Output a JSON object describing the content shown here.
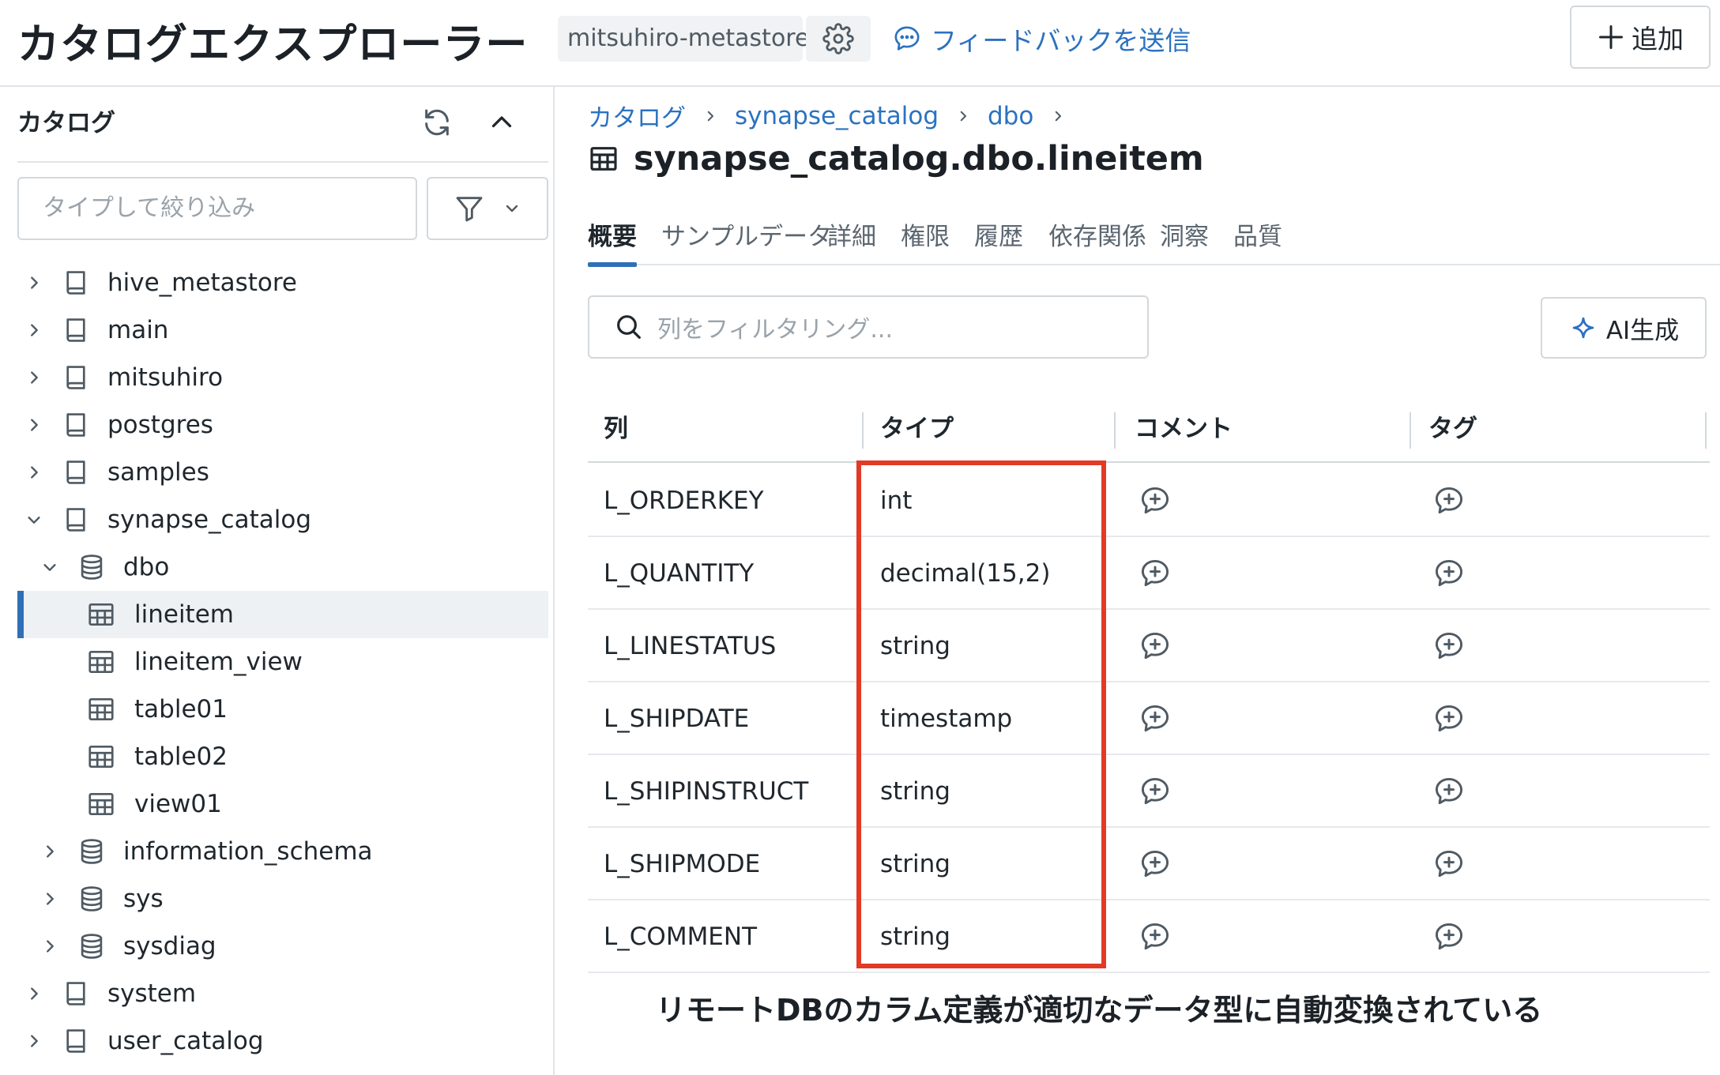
{
  "header": {
    "title": "カタログエクスプローラー",
    "metastore": "mitsuhiro-metastore",
    "feedback_label": "フィードバックを送信",
    "add_label": "追加"
  },
  "sidebar": {
    "title": "カタログ",
    "filter_placeholder": "タイプして絞り込み",
    "items": [
      {
        "label": "hive_metastore",
        "icon": "catalog-book-icon",
        "level": 0,
        "expanded": false
      },
      {
        "label": "main",
        "icon": "catalog-book-icon",
        "level": 0,
        "expanded": false
      },
      {
        "label": "mitsuhiro",
        "icon": "catalog-book-icon",
        "level": 0,
        "expanded": false
      },
      {
        "label": "postgres",
        "icon": "catalog-book-icon",
        "level": 0,
        "expanded": false
      },
      {
        "label": "samples",
        "icon": "catalog-book-icon",
        "level": 0,
        "expanded": false
      },
      {
        "label": "synapse_catalog",
        "icon": "catalog-book-icon",
        "level": 0,
        "expanded": true
      },
      {
        "label": "dbo",
        "icon": "database-icon",
        "level": 1,
        "expanded": true
      },
      {
        "label": "lineitem",
        "icon": "table-icon",
        "level": 2,
        "selected": true
      },
      {
        "label": "lineitem_view",
        "icon": "table-icon",
        "level": 2
      },
      {
        "label": "table01",
        "icon": "table-icon",
        "level": 2
      },
      {
        "label": "table02",
        "icon": "table-icon",
        "level": 2
      },
      {
        "label": "view01",
        "icon": "table-icon",
        "level": 2
      },
      {
        "label": "information_schema",
        "icon": "database-icon",
        "level": 1,
        "expanded": false
      },
      {
        "label": "sys",
        "icon": "database-icon",
        "level": 1,
        "expanded": false
      },
      {
        "label": "sysdiag",
        "icon": "database-icon",
        "level": 1,
        "expanded": false
      },
      {
        "label": "system",
        "icon": "catalog-book-icon",
        "level": 0,
        "expanded": false
      },
      {
        "label": "user_catalog",
        "icon": "catalog-book-icon",
        "level": 0,
        "expanded": false
      }
    ]
  },
  "main": {
    "breadcrumb": [
      "カタログ",
      "synapse_catalog",
      "dbo"
    ],
    "page_title": "synapse_catalog.dbo.lineitem",
    "tabs": [
      {
        "label": "概要",
        "active": true
      },
      {
        "label": "サンプルデータ"
      },
      {
        "label": "詳細"
      },
      {
        "label": "権限"
      },
      {
        "label": "履歴"
      },
      {
        "label": "依存関係"
      },
      {
        "label": "洞察"
      },
      {
        "label": "品質"
      }
    ],
    "column_filter_placeholder": "列をフィルタリング...",
    "ai_button_label": "AI生成",
    "table": {
      "headers": [
        "列",
        "タイプ",
        "コメント",
        "タグ"
      ],
      "rows": [
        {
          "column": "L_ORDERKEY",
          "type": "int"
        },
        {
          "column": "L_QUANTITY",
          "type": "decimal(15,2)"
        },
        {
          "column": "L_LINESTATUS",
          "type": "string"
        },
        {
          "column": "L_SHIPDATE",
          "type": "timestamp"
        },
        {
          "column": "L_SHIPINSTRUCT",
          "type": "string"
        },
        {
          "column": "L_SHIPMODE",
          "type": "string"
        },
        {
          "column": "L_COMMENT",
          "type": "string"
        }
      ]
    }
  },
  "caption": "リモートDBのカラム定義が適切なデータ型に自動変換されている",
  "colors": {
    "accent": "#2f6fb8",
    "link": "#2b72c0",
    "highlight": "#e23a25",
    "selected_bg": "#eef1f4"
  }
}
